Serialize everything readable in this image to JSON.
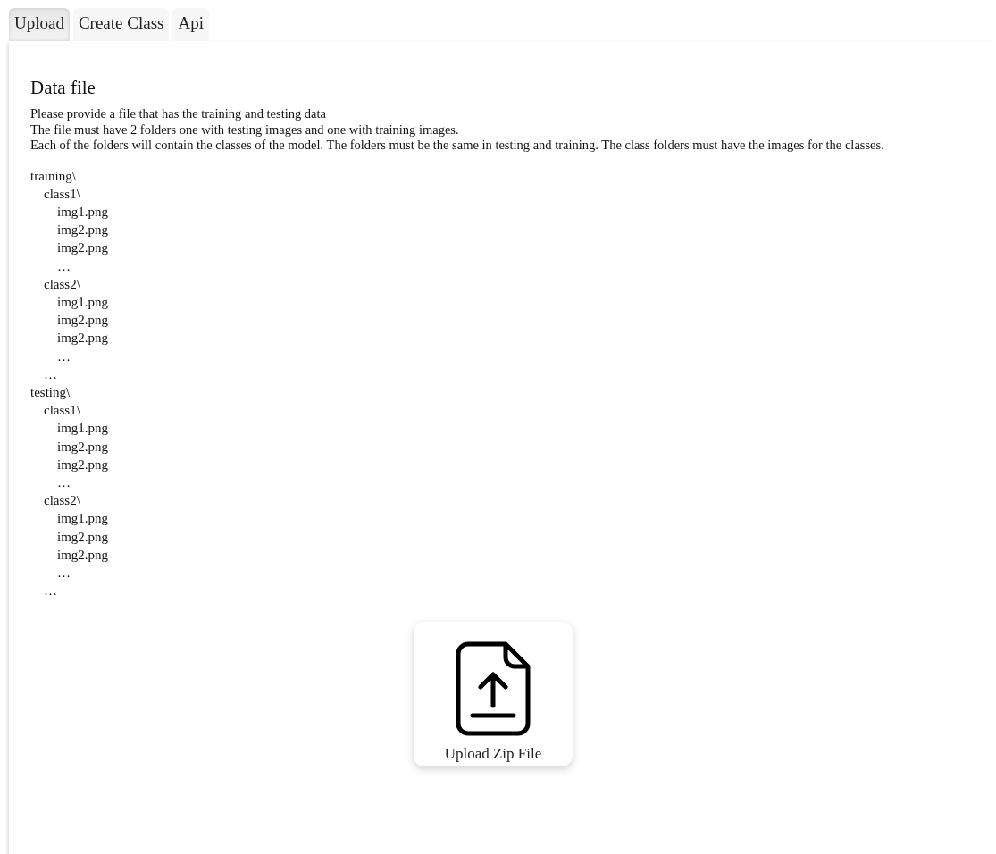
{
  "tabs": [
    {
      "label": "Upload",
      "selected": true
    },
    {
      "label": "Create Class",
      "selected": false
    },
    {
      "label": "Api",
      "selected": false
    }
  ],
  "section": {
    "title": "Data file",
    "description": [
      "Please provide a file that has the training and testing data",
      "The file must have 2 folders one with testing images and one with training images.",
      "Each of the folders will contain the classes of the model. The folders must be the same in testing and training. The class folders must have the images for the classes."
    ],
    "tree": [
      {
        "label": "training\\",
        "children": [
          {
            "label": "class1\\",
            "children": [
              {
                "label": "img1.png"
              },
              {
                "label": "img2.png"
              },
              {
                "label": "img2.png"
              },
              {
                "label": "…"
              }
            ]
          },
          {
            "label": "class2\\",
            "children": [
              {
                "label": "img1.png"
              },
              {
                "label": "img2.png"
              },
              {
                "label": "img2.png"
              },
              {
                "label": "…"
              }
            ]
          },
          {
            "label": "…"
          }
        ]
      },
      {
        "label": "testing\\",
        "children": [
          {
            "label": "class1\\",
            "children": [
              {
                "label": "img1.png"
              },
              {
                "label": "img2.png"
              },
              {
                "label": "img2.png"
              },
              {
                "label": "…"
              }
            ]
          },
          {
            "label": "class2\\",
            "children": [
              {
                "label": "img1.png"
              },
              {
                "label": "img2.png"
              },
              {
                "label": "img2.png"
              },
              {
                "label": "…"
              }
            ]
          },
          {
            "label": "…"
          }
        ]
      }
    ]
  },
  "upload_button": {
    "label": "Upload Zip File"
  }
}
